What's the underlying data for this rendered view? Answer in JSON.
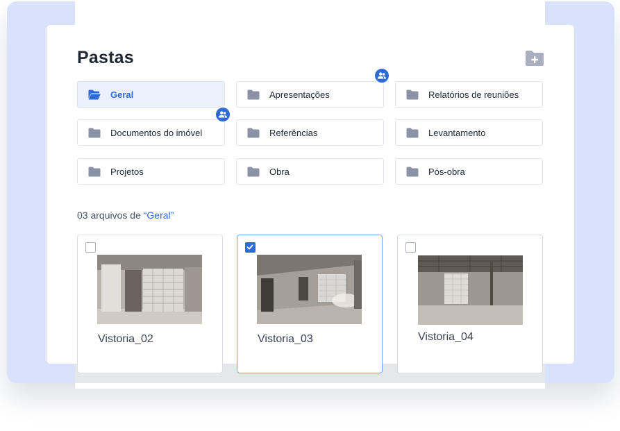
{
  "page": {
    "title": "Pastas",
    "colors": {
      "accent": "#2e6bd6",
      "folder_icon": "#8c92a6",
      "active_bg": "#ebf0fd",
      "backdrop": "#d8e2fb"
    }
  },
  "toolbar": {
    "new_folder_icon": "folder-plus-icon"
  },
  "folders": [
    {
      "label": "Geral",
      "active": true,
      "shared": false
    },
    {
      "label": "Apresentações",
      "active": false,
      "shared": true
    },
    {
      "label": "Relatórios de reuniões",
      "active": false,
      "shared": false
    },
    {
      "label": "Documentos do imóvel",
      "active": false,
      "shared": true
    },
    {
      "label": "Referências",
      "active": false,
      "shared": false
    },
    {
      "label": "Levantamento",
      "active": false,
      "shared": false
    },
    {
      "label": "Projetos",
      "active": false,
      "shared": false
    },
    {
      "label": "Obra",
      "active": false,
      "shared": false
    },
    {
      "label": "Pós-obra",
      "active": false,
      "shared": false
    }
  ],
  "files_summary": {
    "prefix": "03 arquivos de",
    "folder": "“Geral”"
  },
  "files": [
    {
      "name": "Vistoria_02",
      "checked": false
    },
    {
      "name": "Vistoria_03",
      "checked": true
    },
    {
      "name": "Vistoria_04",
      "checked": false
    }
  ]
}
